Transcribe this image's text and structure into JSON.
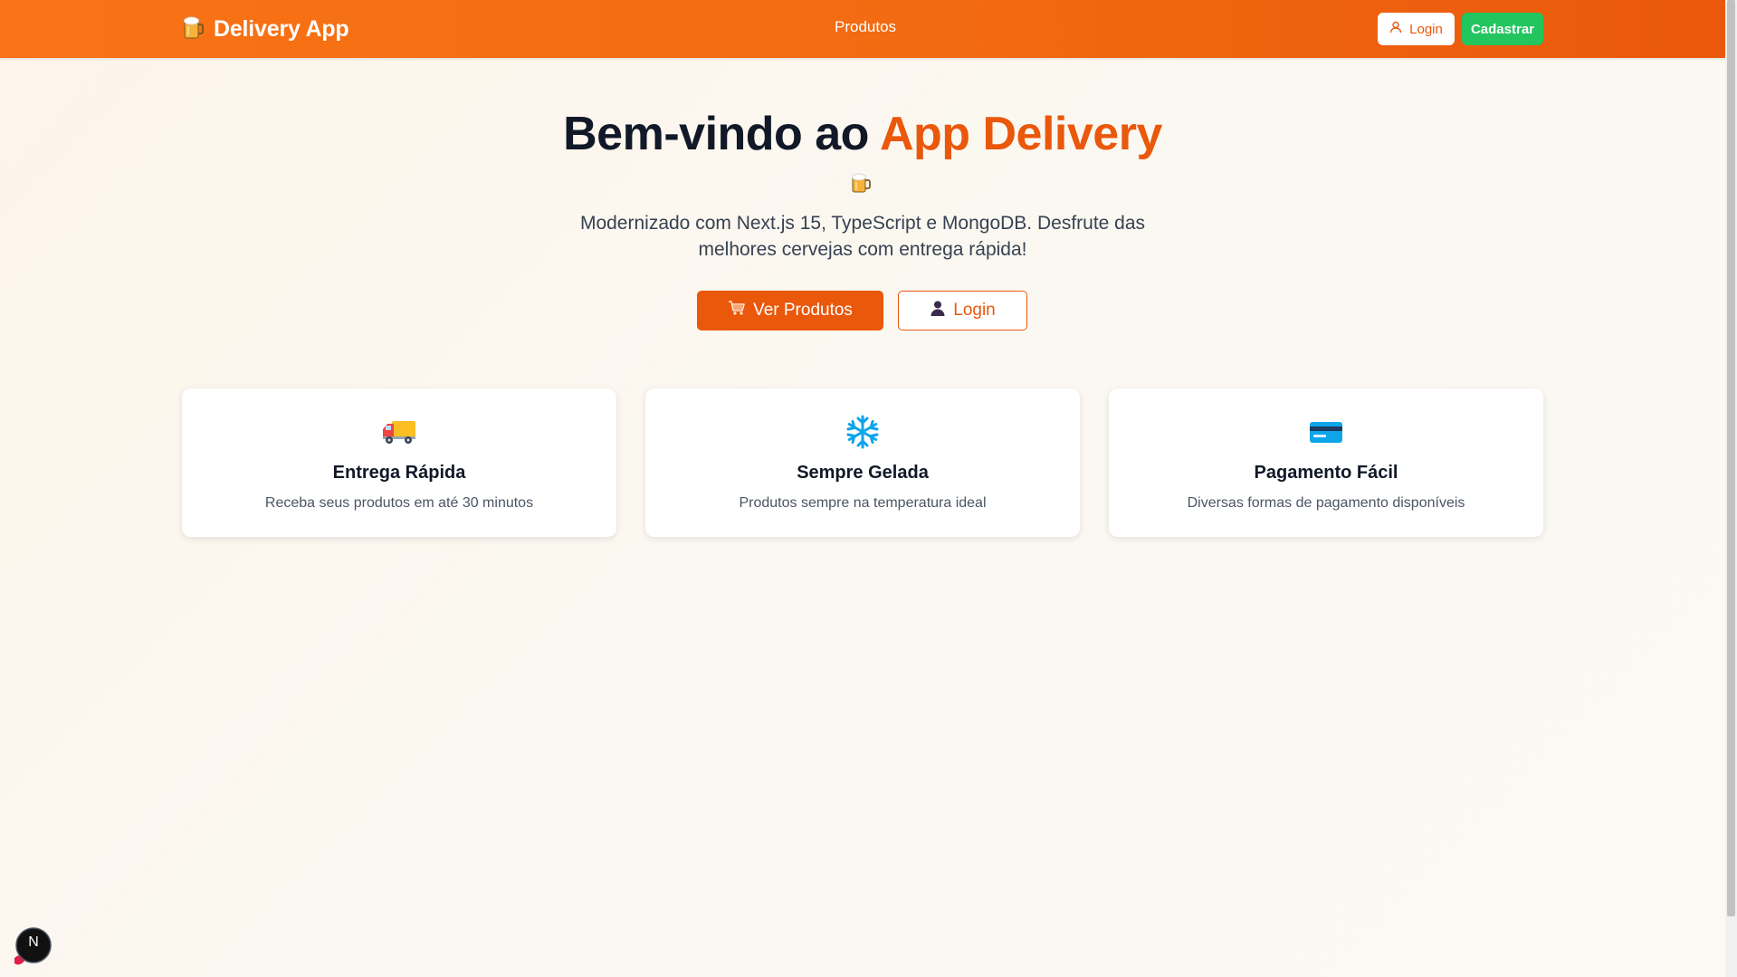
{
  "navbar": {
    "brand": "Delivery App",
    "brand_icon": "beer-mug-icon",
    "links": [
      "Produtos"
    ],
    "login_label": "Login",
    "signup_label": "Cadastrar"
  },
  "hero": {
    "title_prefix": "Bem-vindo ao ",
    "title_accent": "App Delivery",
    "subtitle": "Modernizado com Next.js 15, TypeScript e MongoDB. Desfrute das melhores cervejas com entrega rápida!",
    "primary_button": "Ver Produtos",
    "secondary_button": "Login"
  },
  "features": [
    {
      "icon": "delivery-truck-icon",
      "title": "Entrega Rápida",
      "desc": "Receba seus produtos em até 30 minutos"
    },
    {
      "icon": "snowflake-icon",
      "title": "Sempre Gelada",
      "desc": "Produtos sempre na temperatura ideal"
    },
    {
      "icon": "credit-card-icon",
      "title": "Pagamento Fácil",
      "desc": "Diversas formas de pagamento disponíveis"
    }
  ],
  "dev_badge": "N",
  "colors": {
    "accent": "#ea580c",
    "navbar": "#f97316",
    "signup": "#22c55e",
    "ice": "#0ea5e9"
  }
}
